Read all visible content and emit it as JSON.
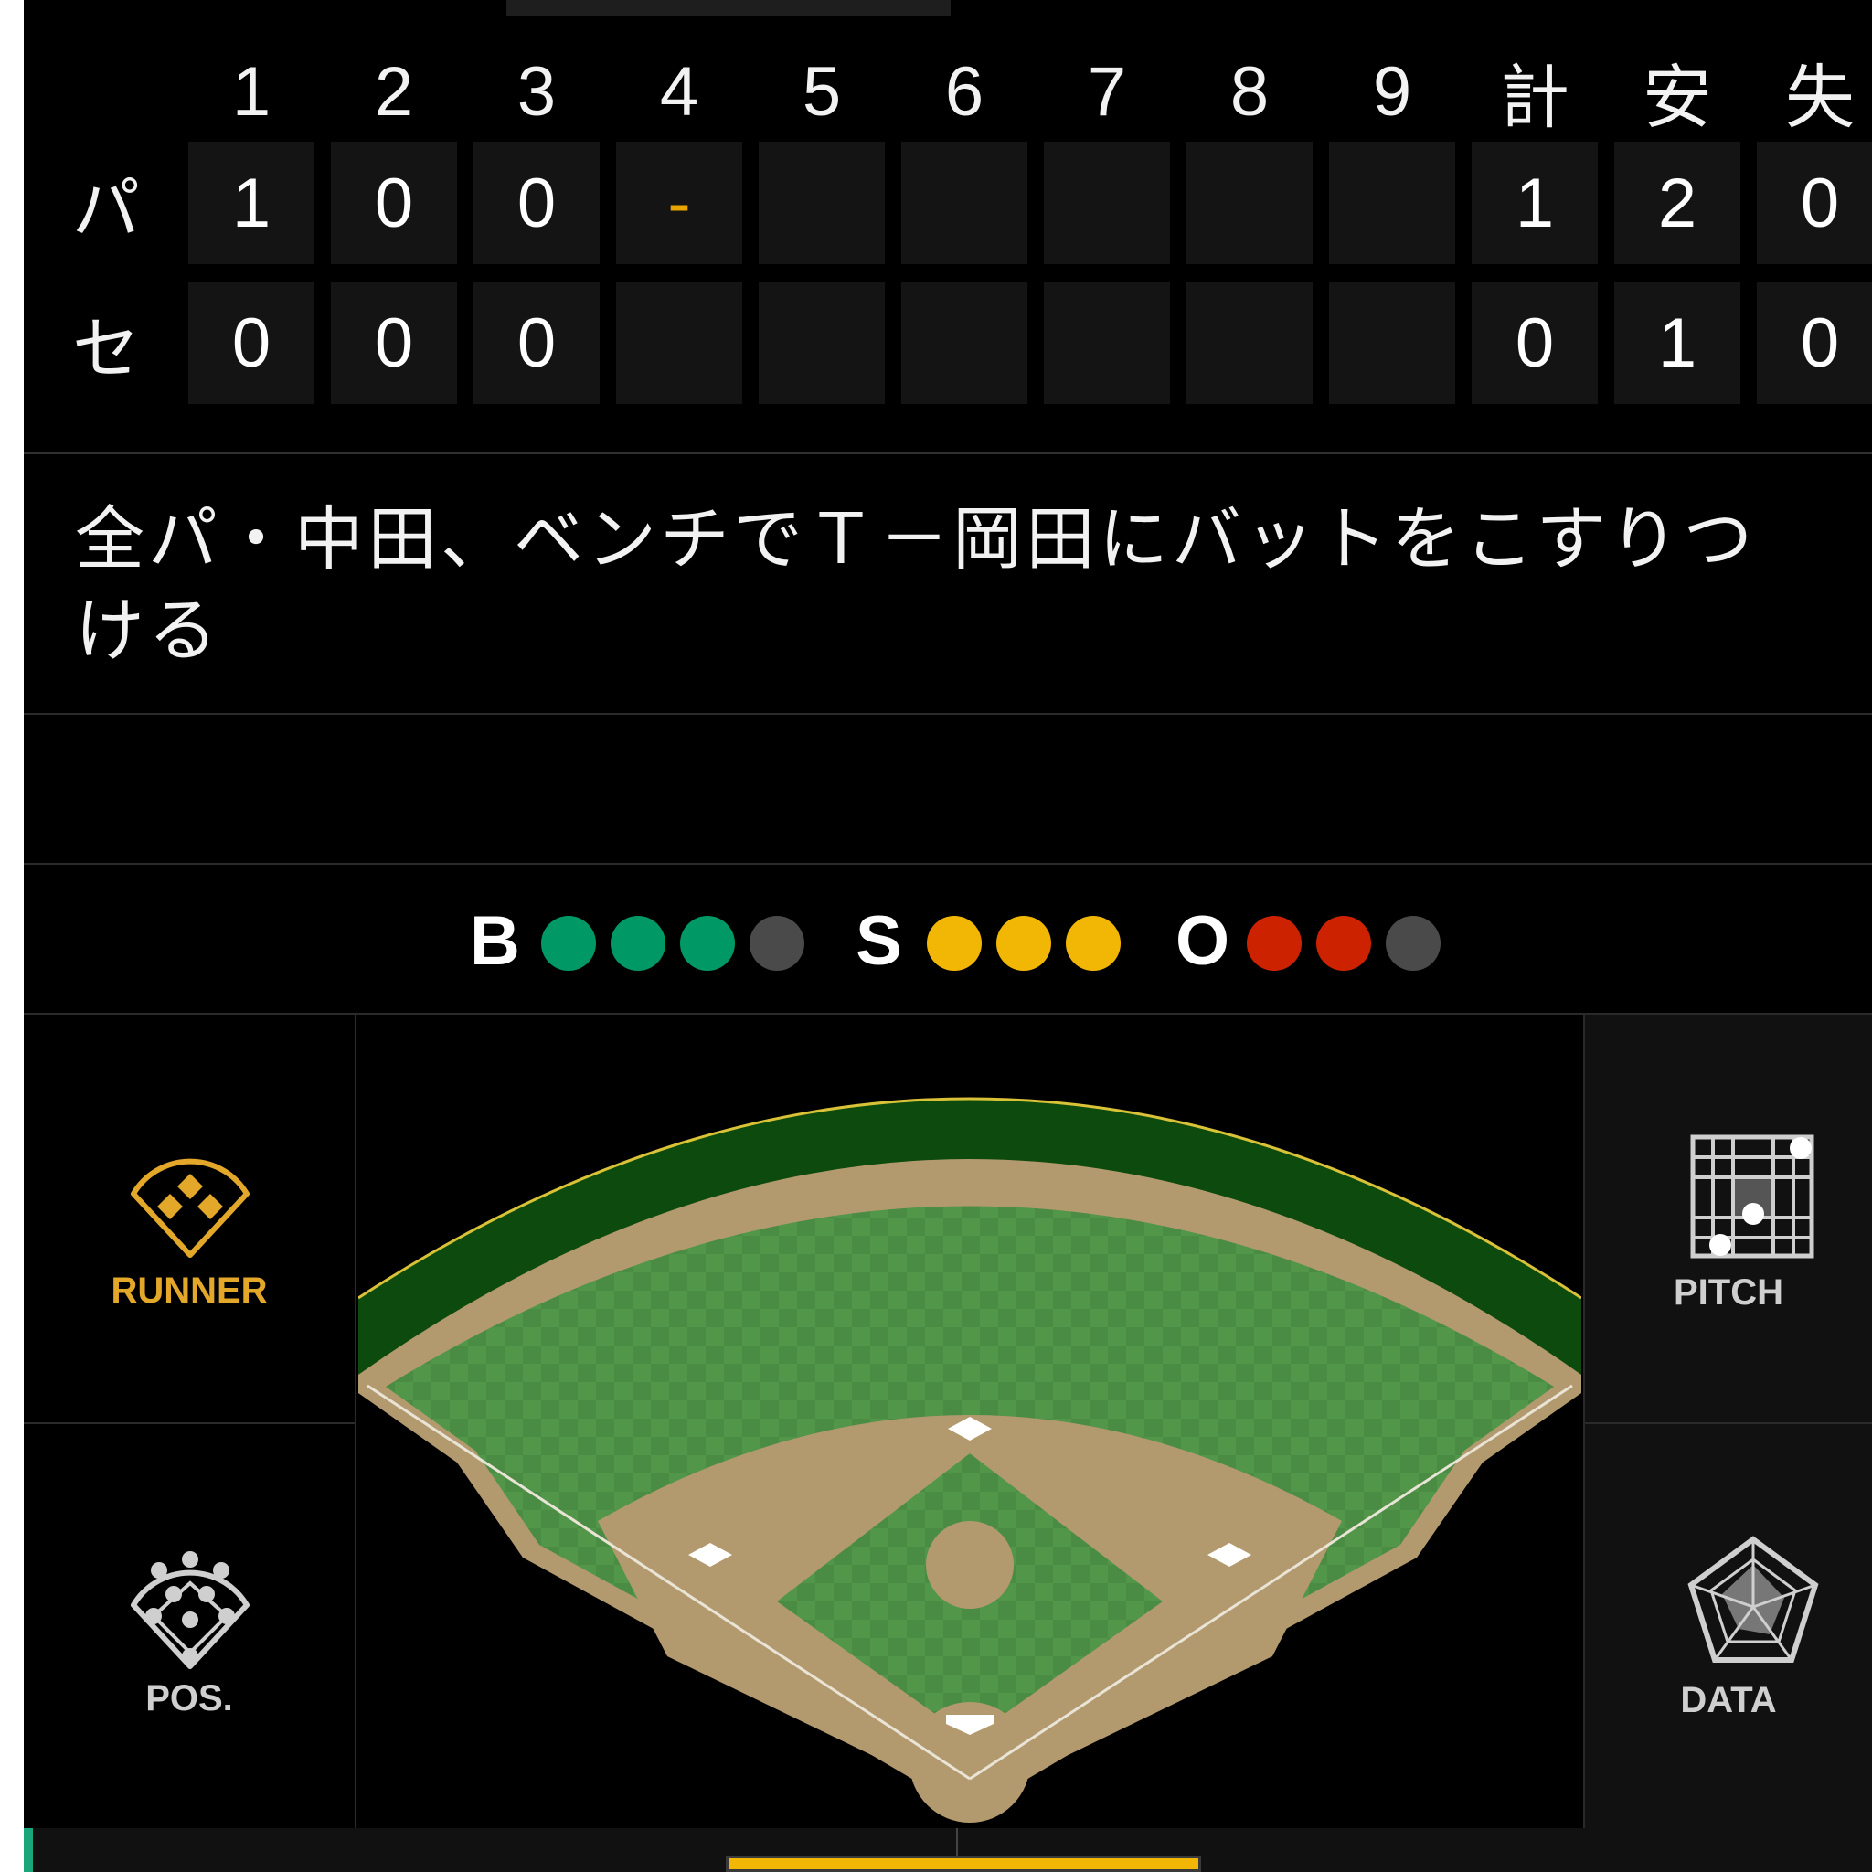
{
  "scoreboard": {
    "headers": [
      "1",
      "2",
      "3",
      "4",
      "5",
      "6",
      "7",
      "8",
      "9",
      "計",
      "安",
      "失"
    ],
    "rows": [
      {
        "team": "パ",
        "innings": [
          "1",
          "0",
          "0",
          "-",
          "",
          "",
          "",
          "",
          "",
          ""
        ],
        "total": "1",
        "hits": "2",
        "errors": "0"
      },
      {
        "team": "セ",
        "innings": [
          "0",
          "0",
          "0",
          "",
          "",
          "",
          "",
          "",
          "",
          ""
        ],
        "total": "0",
        "hits": "1",
        "errors": "0"
      }
    ],
    "current_inning_color": "#e8a400"
  },
  "commentary": {
    "line1": "全パ・中田、ベンチでＴ－岡田にバットをこすりつ",
    "line2": "ける"
  },
  "count": {
    "balls_label": "B",
    "balls": 3,
    "balls_max": 4,
    "strikes_label": "S",
    "strikes": 3,
    "strikes_max": 3,
    "outs_label": "O",
    "outs": 2,
    "outs_max": 3,
    "colors": {
      "ball": "#009966",
      "strike": "#f2b705",
      "out": "#cc2200",
      "off": "#4a4a4a"
    }
  },
  "panels": {
    "runner": {
      "label": "RUNNER",
      "icon": "diamond-bases-icon",
      "color": "#e3a72a"
    },
    "pos": {
      "label": "POS.",
      "icon": "fielder-positions-icon",
      "color": "#cfcfcf"
    },
    "pitch": {
      "label": "PITCH",
      "icon": "strike-zone-grid-icon",
      "color": "#cfcfcf"
    },
    "data": {
      "label": "DATA",
      "icon": "radar-chart-icon",
      "color": "#cfcfcf"
    }
  },
  "field": {
    "outfield_color": "#4a8c44",
    "dirt_color": "#b39a6e",
    "wall_color": "#0d4a0d",
    "icons": [
      "first-base-icon",
      "second-base-icon",
      "third-base-icon",
      "home-plate-icon",
      "pitchers-mound-icon"
    ]
  }
}
